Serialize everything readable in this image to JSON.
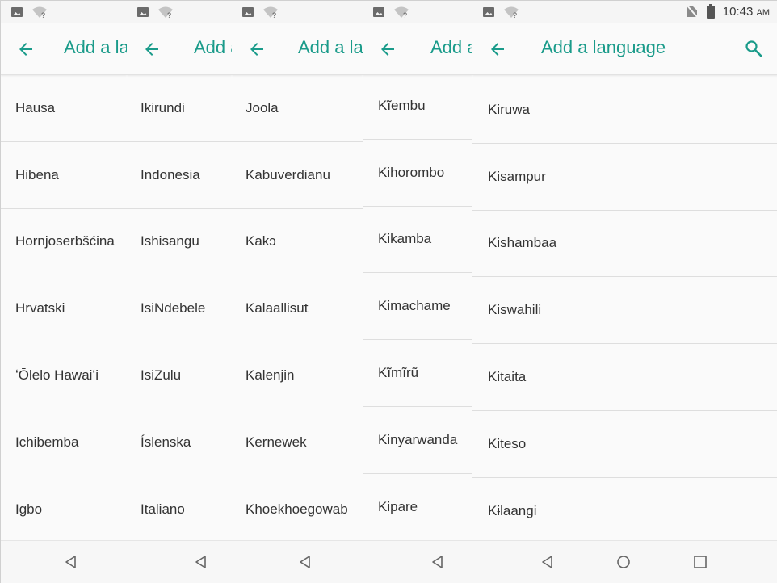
{
  "app": {
    "title": "Add a language",
    "accent_color": "#1a9b8a"
  },
  "status_bar": {
    "time": "10:43",
    "ampm": "AM"
  },
  "icons": {
    "back": "arrow-left-icon",
    "search": "search-icon",
    "image": "image-icon",
    "wifi": "wifi-unknown-icon",
    "no_sim": "no-sim-icon",
    "battery": "battery-icon",
    "nav_back": "nav-back-icon",
    "nav_home": "nav-home-icon",
    "nav_recents": "nav-recents-icon"
  },
  "panels": [
    {
      "items": [
        "Hausa",
        "Hibena",
        "Hornjoserbšćina",
        "Hrvatski",
        "ʻŌlelo Hawaiʻi",
        "Ichibemba",
        "Igbo"
      ]
    },
    {
      "items": [
        "Ikirundi",
        "Indonesia",
        "Ishisangu",
        "IsiNdebele",
        "IsiZulu",
        "Íslenska",
        "Italiano"
      ]
    },
    {
      "items": [
        "Joola",
        "Kabuverdianu",
        "Kakɔ",
        "Kalaallisut",
        "Kalenjin",
        "Kernewek",
        "Khoekhoegowab"
      ]
    },
    {
      "items": [
        "Kĩembu",
        "Kihorombo",
        "Kikamba",
        "Kimachame",
        "Kĩmĩrũ",
        "Kinyarwanda",
        "Kipare"
      ]
    },
    {
      "items": [
        "Kiruwa",
        "Kisampur",
        "Kishambaa",
        "Kiswahili",
        "Kitaita",
        "Kiteso",
        "Kɨlaangi"
      ]
    }
  ]
}
